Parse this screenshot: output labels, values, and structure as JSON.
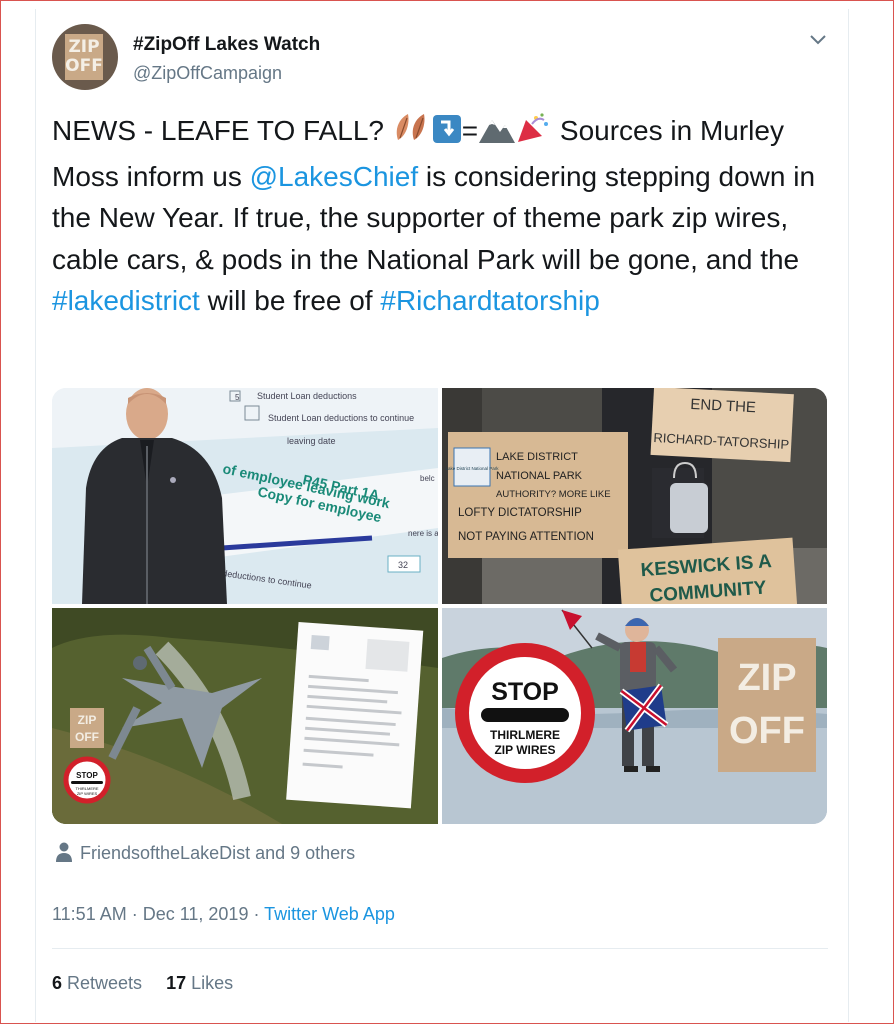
{
  "account": {
    "name": "#ZipOff Lakes Watch",
    "handle": "@ZipOffCampaign",
    "avatar_text": "ZIP OFF"
  },
  "tweet": {
    "text_parts": [
      "NEWS - LEAFE TO FALL? ",
      " Sources in Murley Moss inform us ",
      "@LakesChief",
      " is considering stepping down in the New Year. If true, the supporter of theme park zip wires, cable cars, & pods in the National Park will be gone, and the ",
      "#lakedistrict",
      " will be free of ",
      "#Richardtatorship"
    ],
    "equals": "=",
    "emojis": [
      "leaves-icon",
      "down-arrow-icon",
      "mountain-icon",
      "party-popper-icon"
    ]
  },
  "media": {
    "image1": {
      "lines": [
        "5",
        "Student Loan deductions",
        "Student Loan deductions to continue",
        "leaving date",
        "P45 Part 1A",
        "of employee leaving work",
        "Copy for employee",
        "belc",
        "nere is a",
        "32",
        "deductions to continue",
        "date",
        "ns"
      ]
    },
    "image2": {
      "sign_end": [
        "END THE",
        "RICHARD-TATORSHIP"
      ],
      "sign_lnpa": [
        "LAKE DISTRICT",
        "NATIONAL PARK",
        "AUTHORITY? MORE LIKE",
        "LOFTY DICTATORSHIP",
        "NOT PAYING ATTENTION"
      ],
      "logo_text": "Lake District National Park",
      "sign_keswick": [
        "KESWICK IS A",
        "COMMUNITY"
      ]
    },
    "image3": {
      "zip_sign": [
        "ZIP",
        "OFF"
      ],
      "stop": [
        "STOP",
        "THIRLMERE",
        "ZIP WIRES"
      ]
    },
    "image4": {
      "stop": [
        "STOP",
        "THIRLMERE",
        "ZIP WIRES"
      ],
      "zip_sign": [
        "ZIP",
        "OFF"
      ]
    }
  },
  "liked_by": "FriendsoftheLakeDist and 9 others",
  "meta": {
    "time": "11:51 AM · Dec 11, 2019 · ",
    "source": "Twitter Web App"
  },
  "stats": {
    "retweets_count": "6",
    "retweets_label": " Retweets",
    "likes_count": "17",
    "likes_label": " Likes"
  },
  "colors": {
    "link": "#1b95e0",
    "secondary_text": "#657786",
    "border": "#e6ecf0"
  }
}
